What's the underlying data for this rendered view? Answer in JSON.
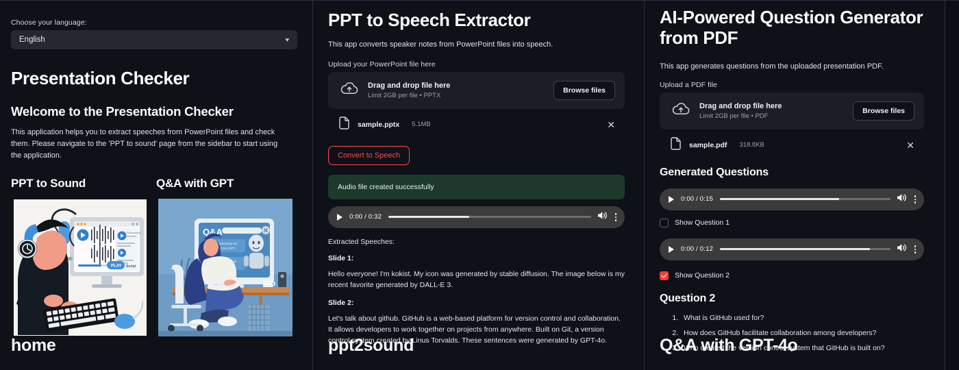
{
  "home": {
    "language_label": "Choose your language:",
    "language_value": "English",
    "title": "Presentation Checker",
    "welcome_heading": "Welcome to the Presentation Checker",
    "description": "This application helps you to extract speeches from PowerPoint files and check them. Please navigate to the 'PPT to sound' page from the sidebar to start using the application.",
    "cards": [
      {
        "title": "PPT to Sound",
        "image_alt": "Illustration of a person with headphones at a computer with audio waveforms, microphone and PLAY button"
      },
      {
        "title": "Q&A with GPT",
        "image_alt": "Illustration of a person at a desk facing a monitor showing a Q&A chat with an AI robot"
      }
    ],
    "page_tag": "home"
  },
  "ppt": {
    "title": "PPT to Speech Extractor",
    "description": "This app converts speaker notes from PowerPoint files into speech.",
    "upload_label": "Upload your PowerPoint file here",
    "dropzone": {
      "main": "Drag and drop file here",
      "limit": "Limit 2GB per file • PPTX",
      "browse_label": "Browse files"
    },
    "file": {
      "name": "sample.pptx",
      "size": "5.1MB"
    },
    "convert_button": "Convert to Speech",
    "alert": "Audio file created successfully",
    "audio": {
      "time": "0:00 / 0:32",
      "progress_percent": 40
    },
    "speeches_label": "Extracted Speeches:",
    "slides": [
      {
        "heading": "Slide 1:",
        "text": "Hello everyone! I'm kokist. My icon was generated by stable diffusion. The image below is my recent favorite generated by DALL-E 3."
      },
      {
        "heading": "Slide 2:",
        "text": "Let's talk about github. GitHub is a web-based platform for version control and collaboration. It allows developers to work together on projects from anywhere. Built on Git, a version control system created by Linus Torvalds. These sentences were generated by GPT-4o."
      }
    ],
    "page_tag": "ppt2sound"
  },
  "qa": {
    "title": "AI-Powered Question Generator from PDF",
    "description": "This app generates questions from the uploaded presentation PDF.",
    "upload_label": "Upload a PDF file",
    "dropzone": {
      "main": "Drag and drop file here",
      "limit": "Limit 2GB per file • PDF",
      "browse_label": "Browse files"
    },
    "file": {
      "name": "sample.pdf",
      "size": "318.8KB"
    },
    "generated_heading": "Generated Questions",
    "audio1": {
      "time": "0:00 / 0:15",
      "progress_percent": 70
    },
    "checkbox1": {
      "label": "Show Question 1",
      "checked": false
    },
    "audio2": {
      "time": "0:00 / 0:12",
      "progress_percent": 88
    },
    "checkbox2": {
      "label": "Show Question 2",
      "checked": true
    },
    "question_heading": "Question 2",
    "questions": [
      "What is GitHub used for?",
      "How does GitHub facilitate collaboration among developers?",
      "Who created the version control system that GitHub is built on?"
    ],
    "page_tag": "Q&A with GPT-4o"
  },
  "colors": {
    "background": "#0e1117",
    "panel_border": "#2b3040",
    "accent_danger": "#ff4b4b",
    "success_bg": "#1b3a2b",
    "widget_bg": "#262730",
    "audio_bg": "#3b3b3b",
    "checkbox_on": "#ff3b30"
  }
}
